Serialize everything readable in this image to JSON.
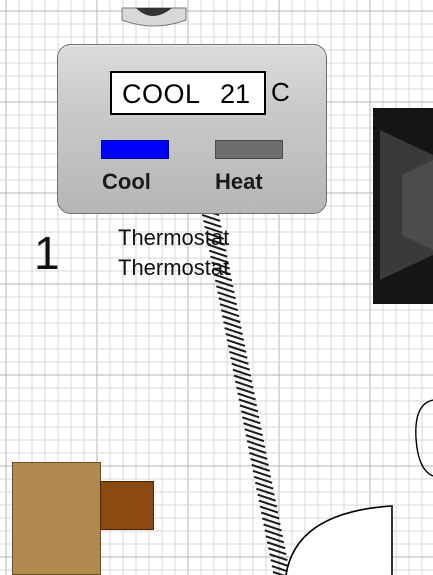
{
  "thermostat": {
    "display_mode": "COOL",
    "display_temp": "21",
    "unit": "C",
    "cool_label": "Cool",
    "heat_label": "Heat",
    "cool_color": "#0000ff",
    "heat_color": "#6e6e6e"
  },
  "labels": {
    "caption_1": "Thermostat",
    "caption_2": "Thermostat",
    "node_number": "1"
  },
  "colors": {
    "grid_major": "#b4b4b4",
    "grid_minor": "#d9d9d9",
    "box_fill": "#b08a4e",
    "stub_fill": "#8b4a12"
  }
}
